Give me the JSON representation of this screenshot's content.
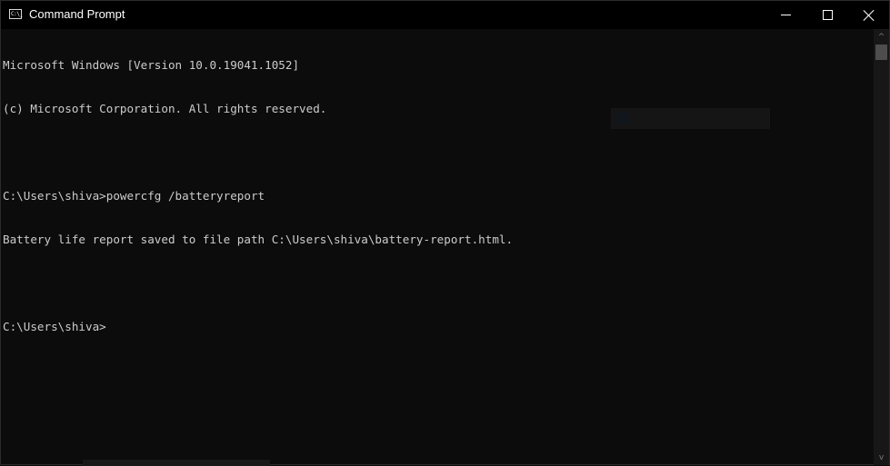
{
  "window": {
    "title": "Command Prompt",
    "app_icon": "cmd-icon",
    "app_icon_text": "C:\\_",
    "controls": {
      "minimize": "minimize-icon",
      "maximize": "maximize-icon",
      "close": "close-icon"
    }
  },
  "console": {
    "lines": [
      "Microsoft Windows [Version 10.0.19041.1052]",
      "(c) Microsoft Corporation. All rights reserved.",
      "",
      "C:\\Users\\shiva>powercfg /batteryreport",
      "Battery life report saved to file path C:\\Users\\shiva\\battery-report.html.",
      "",
      "C:\\Users\\shiva>"
    ]
  },
  "scrollbar": {
    "up_arrow": "^",
    "down_arrow": "v"
  },
  "colors": {
    "background": "#0c0c0c",
    "text": "#cccccc",
    "titlebar": "#000000"
  }
}
